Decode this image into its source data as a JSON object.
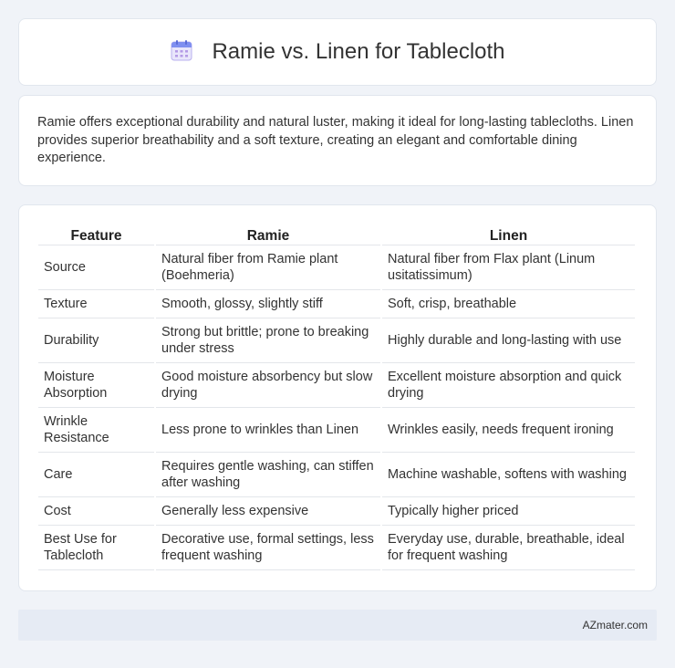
{
  "header": {
    "title": "Ramie vs. Linen for Tablecloth",
    "icon": "calendar-icon"
  },
  "intro": {
    "text": "Ramie offers exceptional durability and natural luster, making it ideal for long-lasting tablecloths. Linen provides superior breathability and a soft texture, creating an elegant and comfortable dining experience."
  },
  "table": {
    "headers": [
      "Feature",
      "Ramie",
      "Linen"
    ],
    "rows": [
      [
        "Source",
        "Natural fiber from Ramie plant (Boehmeria)",
        "Natural fiber from Flax plant (Linum usitatissimum)"
      ],
      [
        "Texture",
        "Smooth, glossy, slightly stiff",
        "Soft, crisp, breathable"
      ],
      [
        "Durability",
        "Strong but brittle; prone to breaking under stress",
        "Highly durable and long-lasting with use"
      ],
      [
        "Moisture Absorption",
        "Good moisture absorbency but slow drying",
        "Excellent moisture absorption and quick drying"
      ],
      [
        "Wrinkle Resistance",
        "Less prone to wrinkles than Linen",
        "Wrinkles easily, needs frequent ironing"
      ],
      [
        "Care",
        "Requires gentle washing, can stiffen after washing",
        "Machine washable, softens with washing"
      ],
      [
        "Cost",
        "Generally less expensive",
        "Typically higher priced"
      ],
      [
        "Best Use for Tablecloth",
        "Decorative use, formal settings, less frequent washing",
        "Everyday use, durable, breathable, ideal for frequent washing"
      ]
    ]
  },
  "footer": {
    "brand": "AZmater.com"
  }
}
